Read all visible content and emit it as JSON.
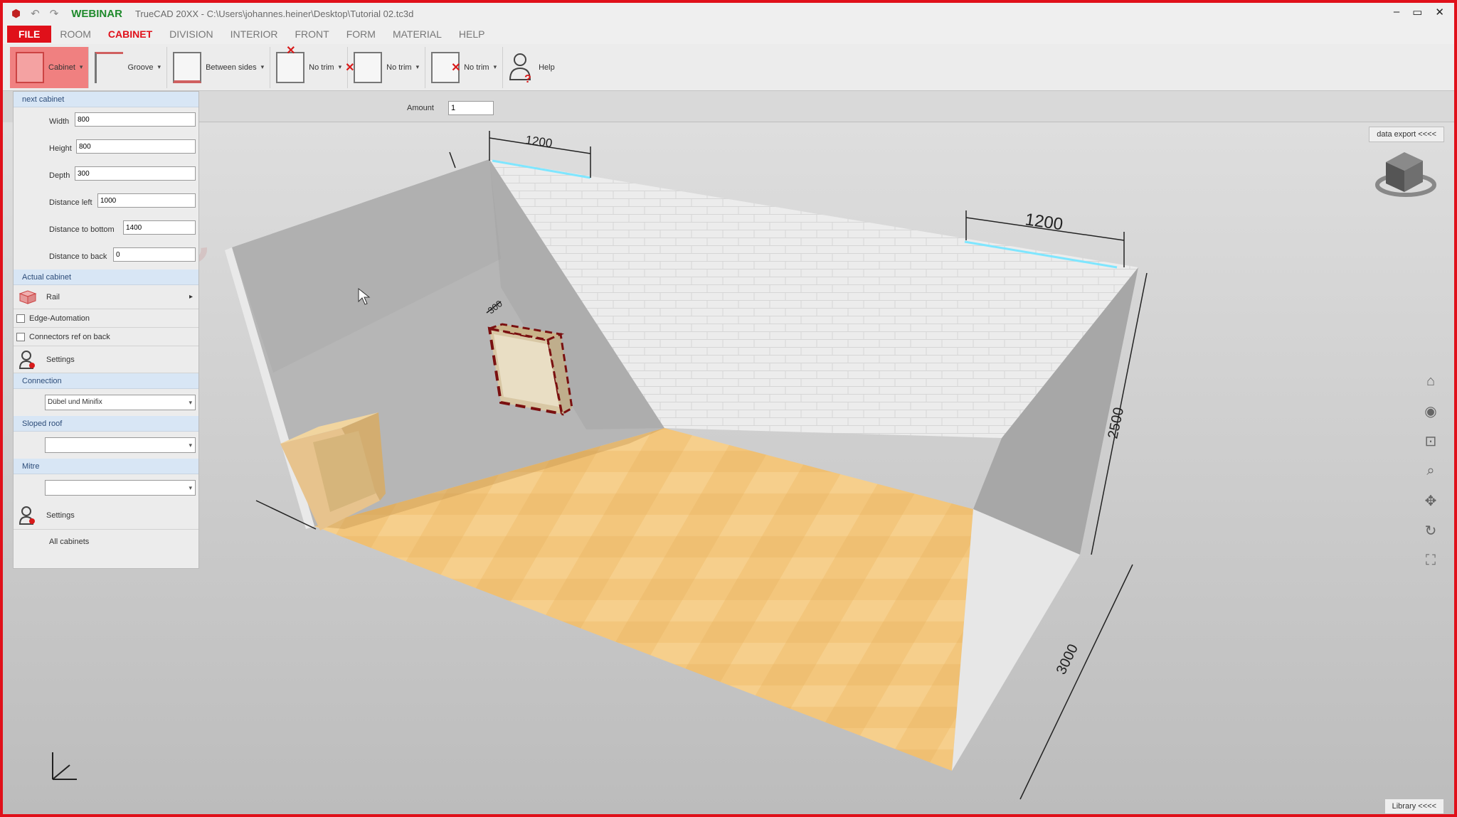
{
  "titlebar": {
    "brand": "WEBINAR",
    "path": "TrueCAD 20XX - C:\\Users\\johannes.heiner\\Desktop\\Tutorial 02.tc3d",
    "minimize": "‒",
    "restore": "▭",
    "close": "✕"
  },
  "tabs": [
    "FILE",
    "ROOM",
    "CABINET",
    "DIVISION",
    "INTERIOR",
    "FRONT",
    "FORM",
    "MATERIAL",
    "HELP"
  ],
  "active_tab": "CABINET",
  "ribbon": {
    "cabinet": "Cabinet",
    "groove": "Groove",
    "between_sides": "Between sides",
    "no_trim_1": "No trim",
    "no_trim_2": "No trim",
    "no_trim_3": "No trim",
    "help": "Help"
  },
  "options": {
    "amount_label": "Amount",
    "amount_value": "1"
  },
  "panel": {
    "next_cabinet": "next cabinet",
    "width_label": "Width",
    "width_value": "800",
    "height_label": "Height",
    "height_value": "800",
    "depth_label": "Depth",
    "depth_value": "300",
    "dist_left_label": "Distance left",
    "dist_left_value": "1000",
    "dist_bottom_label": "Distance to bottom",
    "dist_bottom_value": "1400",
    "dist_back_label": "Distance to back",
    "dist_back_value": "0",
    "actual_cabinet": "Actual cabinet",
    "rail": "Rail",
    "edge_automation": "Edge-Automation",
    "connectors": "Connectors ref on back",
    "settings1": "Settings",
    "connection_section": "Connection",
    "connection_value": "Dübel und Minifix",
    "sloped_roof": "Sloped roof",
    "sloped_value": "",
    "mitre": "Mitre",
    "mitre_value": "",
    "settings2": "Settings",
    "all_cabinets": "All cabinets"
  },
  "viewport": {
    "data_export": "data export <<<<",
    "library": "Library <<<<",
    "dim_top_left": "1200",
    "dim_top_right": "1200",
    "dim_cabinet_depth": "300",
    "dim_height": "2500",
    "dim_depth": "3000",
    "watermark": "PC"
  },
  "colors": {
    "accent": "#e0101a",
    "brand": "#1f8a2c",
    "floor": "#f2c47a",
    "wall": "#e8e8e8"
  }
}
